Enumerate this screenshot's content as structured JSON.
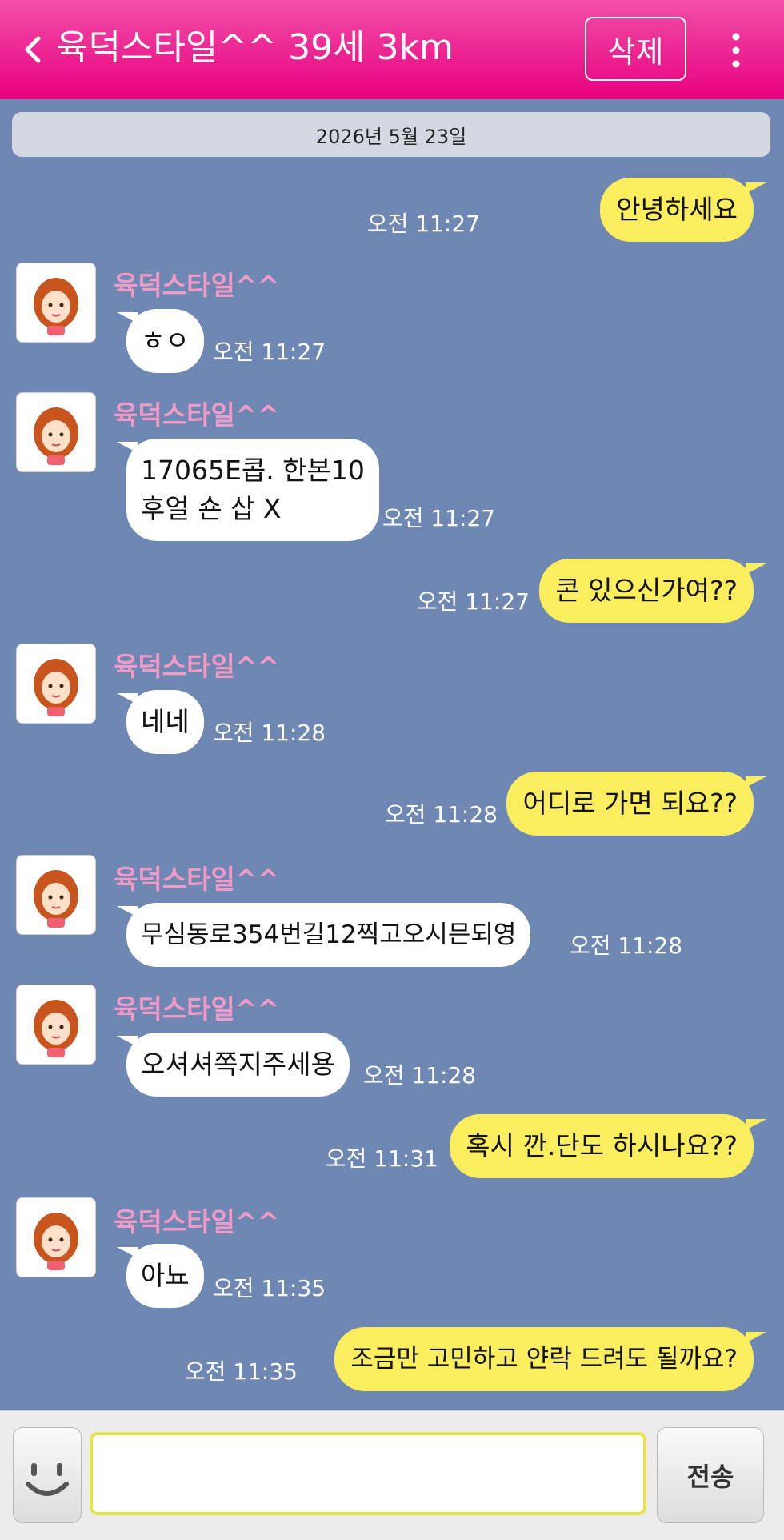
{
  "header": {
    "title": "육덕스타일^^ 39세 3km",
    "delete_label": "삭제",
    "icons": [
      "chevron-left-icon",
      "more-vertical-icon"
    ],
    "colors": {
      "primary": "#e8007f",
      "chat_bg": "#6e88b3",
      "my_bubble": "#fbee5e"
    }
  },
  "date_divider": "2026년 5월 23일",
  "messages": [
    {
      "from": "me",
      "text": "안녕하세요",
      "time": "오전 11:27"
    },
    {
      "from": "them",
      "sender": "육덕스타일^^",
      "text": "ㅎㅇ",
      "time": "오전 11:27"
    },
    {
      "from": "them",
      "sender": "육덕스타일^^",
      "line1": "17065E콥. 한본10",
      "line2": "후얼 숀 삽 X",
      "time": "오전 11:27"
    },
    {
      "from": "me",
      "text": "콘 있으신가여??",
      "time": "오전 11:27"
    },
    {
      "from": "them",
      "sender": "육덕스타일^^",
      "text": "네네",
      "time": "오전 11:28"
    },
    {
      "from": "me",
      "text": "어디로 가면 되요??",
      "time": "오전 11:28"
    },
    {
      "from": "them",
      "sender": "육덕스타일^^",
      "text": "무심동로354번길12찍고오시믄되영",
      "time": "오전 11:28"
    },
    {
      "from": "them",
      "sender": "육덕스타일^^",
      "text": "오셔셔쪽지주세용",
      "time": "오전 11:28"
    },
    {
      "from": "me",
      "text": "혹시 깐.단도 하시나요??",
      "time": "오전 11:31"
    },
    {
      "from": "them",
      "sender": "육덕스타일^^",
      "text": "아뇨",
      "time": "오전 11:35"
    },
    {
      "from": "me",
      "text": "조금만 고민하고 얀락 드려도 될까요?",
      "time": "오전 11:35"
    }
  ],
  "composer": {
    "input_value": "",
    "send_label": "전송",
    "emoji_icon": "smiley-icon"
  }
}
